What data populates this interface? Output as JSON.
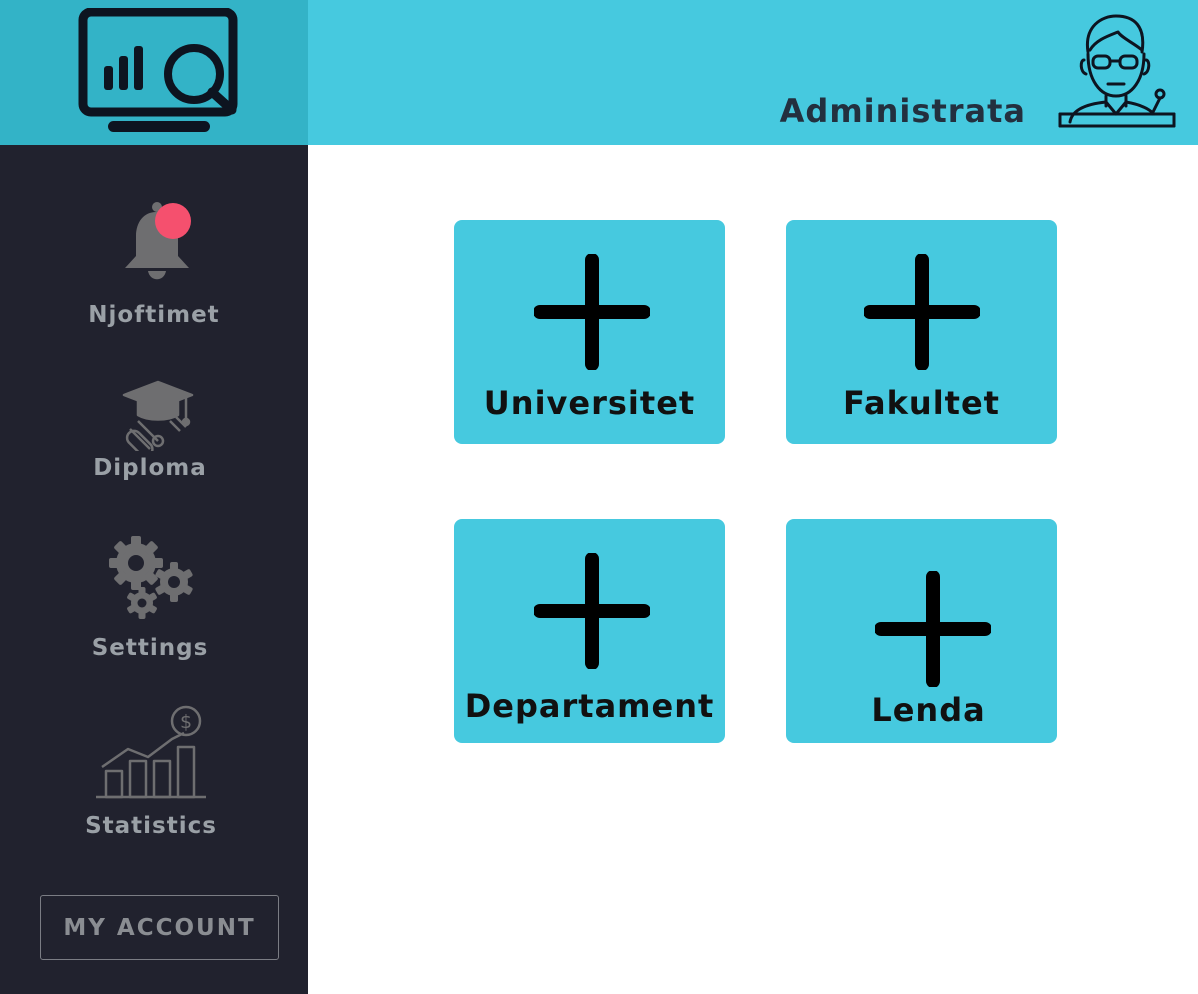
{
  "header": {
    "user_name": "Administrata"
  },
  "sidebar": {
    "items": [
      {
        "label": "Njoftimet",
        "icon": "bell-icon",
        "has_badge": true,
        "badge_color": "#f5506e"
      },
      {
        "label": "Diploma",
        "icon": "graduation-cap-icon"
      },
      {
        "label": "Settings",
        "icon": "gears-icon"
      },
      {
        "label": "Statistics",
        "icon": "statistics-icon"
      }
    ],
    "account_button": "MY ACCOUNT"
  },
  "main": {
    "tiles": [
      {
        "label": "Universitet",
        "icon": "plus-icon"
      },
      {
        "label": "Fakultet",
        "icon": "plus-icon"
      },
      {
        "label": "Departament",
        "icon": "plus-icon"
      },
      {
        "label": "Lenda",
        "icon": "plus-icon"
      }
    ]
  },
  "colors": {
    "accent": "#46c9df",
    "logo_bg": "#33b3c7",
    "sidebar_bg": "#21222e",
    "sidebar_text": "#9aa0a6",
    "badge": "#f5506e"
  }
}
